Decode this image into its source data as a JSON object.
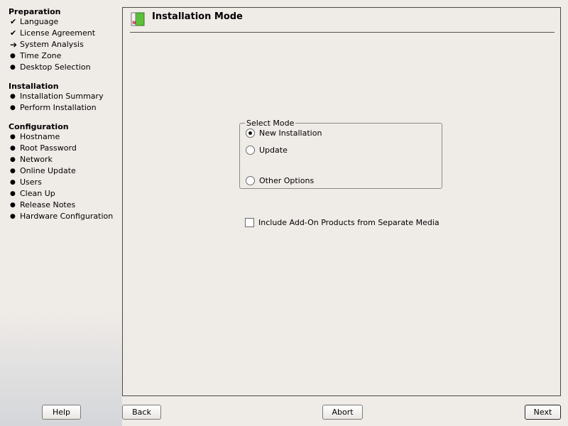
{
  "sidebar": {
    "sections": [
      {
        "title": "Preparation",
        "items": [
          {
            "label": "Language",
            "status": "done"
          },
          {
            "label": "License Agreement",
            "status": "done"
          },
          {
            "label": "System Analysis",
            "status": "current"
          },
          {
            "label": "Time Zone",
            "status": "pending"
          },
          {
            "label": "Desktop Selection",
            "status": "pending"
          }
        ]
      },
      {
        "title": "Installation",
        "items": [
          {
            "label": "Installation Summary",
            "status": "pending"
          },
          {
            "label": "Perform Installation",
            "status": "pending"
          }
        ]
      },
      {
        "title": "Configuration",
        "items": [
          {
            "label": "Hostname",
            "status": "pending"
          },
          {
            "label": "Root Password",
            "status": "pending"
          },
          {
            "label": "Network",
            "status": "pending"
          },
          {
            "label": "Online Update",
            "status": "pending"
          },
          {
            "label": "Users",
            "status": "pending"
          },
          {
            "label": "Clean Up",
            "status": "pending"
          },
          {
            "label": "Release Notes",
            "status": "pending"
          },
          {
            "label": "Hardware Configuration",
            "status": "pending"
          }
        ]
      }
    ],
    "marks": {
      "done": "✔",
      "current": "➔",
      "pending": "●"
    }
  },
  "main": {
    "title": "Installation Mode",
    "icon": "suse-installer-icon",
    "mode_group": {
      "legend": "Select Mode",
      "options": [
        {
          "label": "New Installation",
          "checked": true
        },
        {
          "label": "Update",
          "checked": false
        },
        {
          "label": "Other Options",
          "checked": false
        }
      ]
    },
    "addon_checkbox": {
      "label": "Include Add-On Products from Separate Media",
      "checked": false
    }
  },
  "buttons": {
    "help": "Help",
    "back": "Back",
    "abort": "Abort",
    "next": "Next"
  },
  "colors": {
    "background": "#efebe7",
    "icon_green": "#5cbf3a",
    "icon_red": "#c8102e"
  }
}
